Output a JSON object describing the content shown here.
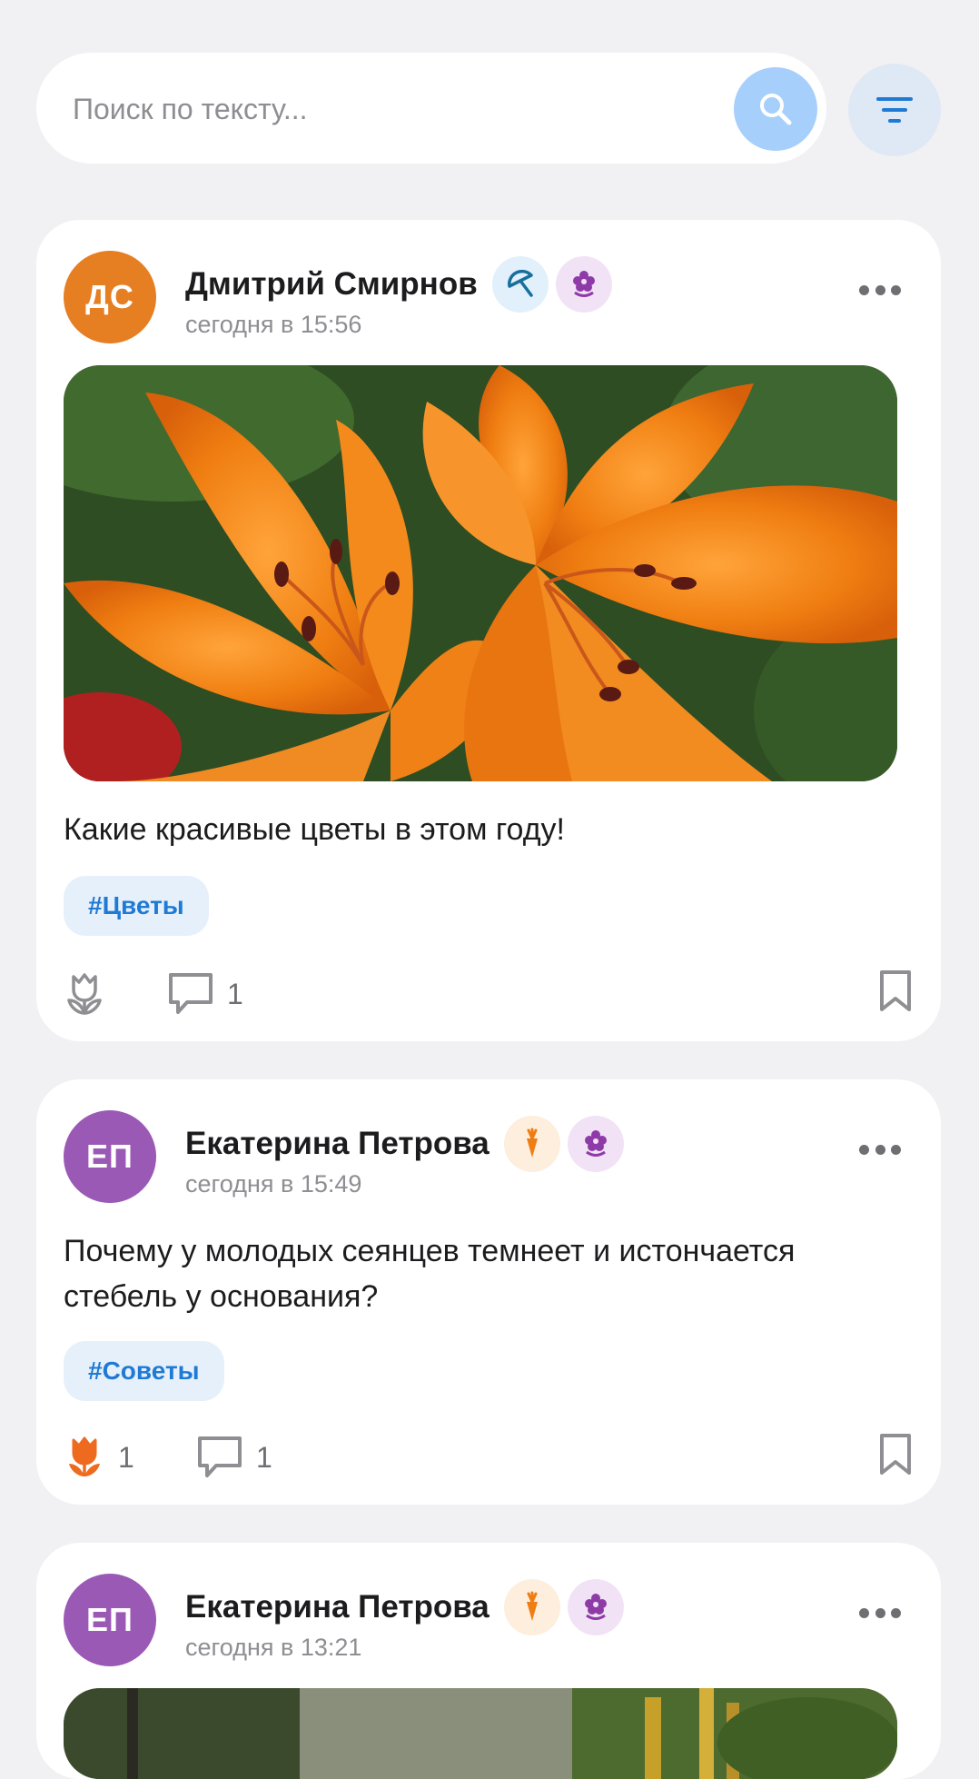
{
  "search": {
    "placeholder": "Поиск по тексту...",
    "value": ""
  },
  "colors": {
    "accent": "#1f7ad6",
    "search_button": "#a7cffc",
    "filter_button": "#dfe9f5"
  },
  "posts": [
    {
      "avatar_initials": "ДС",
      "avatar_color": "#e67e22",
      "author": "Дмитрий Смирнов",
      "time": "сегодня в 15:56",
      "badges": [
        "umbrella-icon",
        "flower-icon"
      ],
      "has_image": true,
      "image": "orange-lilies-photo",
      "text": "Какие красивые цветы в этом году!",
      "tag": "#Цветы",
      "likes": "",
      "liked": false,
      "comments": "1"
    },
    {
      "avatar_initials": "ЕП",
      "avatar_color": "#9b59b6",
      "author": "Екатерина Петрова",
      "time": "сегодня в 15:49",
      "badges": [
        "carrot-icon",
        "flower-icon"
      ],
      "has_image": false,
      "text": "Почему у молодых сеянцев темнеет и истончается стебель у основания?",
      "tag": "#Советы",
      "likes": "1",
      "liked": true,
      "comments": "1"
    },
    {
      "avatar_initials": "ЕП",
      "avatar_color": "#9b59b6",
      "author": "Екатерина Петрова",
      "time": "сегодня в 13:21",
      "badges": [
        "carrot-icon",
        "flower-icon"
      ],
      "has_image": true,
      "image": "garden-photo"
    }
  ]
}
